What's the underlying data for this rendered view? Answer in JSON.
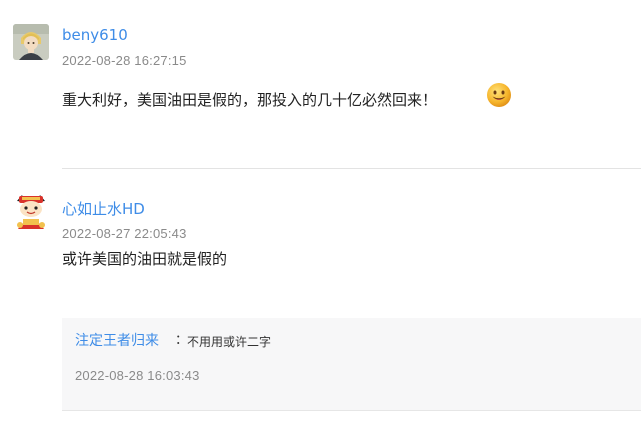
{
  "comments": [
    {
      "avatar_icon": "anime-character-avatar",
      "username": "beny610",
      "timestamp": "2022-08-28 16:27:15",
      "text": "重大利好，美国油田是假的，那投入的几十亿必然回来！",
      "emoji_icon": "smile-emoji-icon",
      "replies": []
    },
    {
      "avatar_icon": "lucky-cat-avatar",
      "username": "心如止水HD",
      "timestamp": "2022-08-27 22:05:43",
      "text": "或许美国的油田就是假的",
      "replies": [
        {
          "username": "注定王者归来",
          "separator": "：",
          "text": "不用用或许二字",
          "timestamp": "2022-08-28 16:03:43"
        }
      ]
    }
  ],
  "colors": {
    "username": "#3e8ce7",
    "timestamp": "#8a8a8a",
    "text": "#222222",
    "divider": "#e3e3e3",
    "reply_background": "#f7f7f8"
  }
}
